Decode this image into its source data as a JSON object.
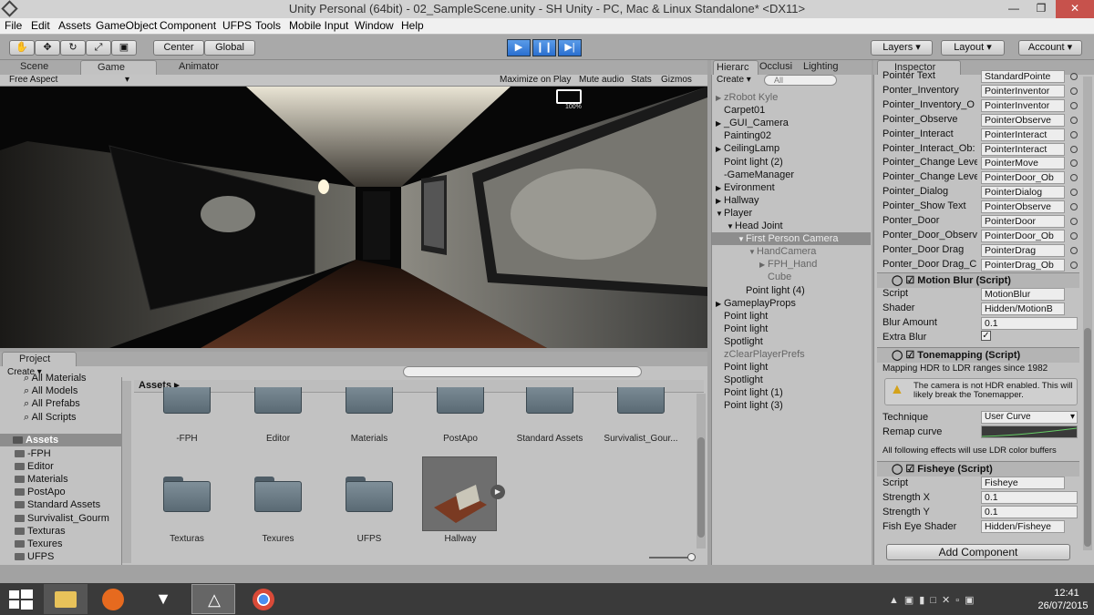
{
  "window": {
    "title": "Unity Personal (64bit) - 02_SampleScene.unity - SH Unity - PC, Mac & Linux Standalone* <DX11>"
  },
  "menu": [
    "File",
    "Edit",
    "Assets",
    "GameObject",
    "Component",
    "UFPS",
    "Tools",
    "Mobile Input",
    "Window",
    "Help"
  ],
  "toolbar": {
    "center": "Center",
    "global": "Global",
    "layers": "Layers",
    "layout": "Layout",
    "account": "Account"
  },
  "scene_tabs": {
    "scene": "Scene",
    "game": "Game",
    "animator": "Animator"
  },
  "game_bar": {
    "aspect": "Free Aspect",
    "maximize": "Maximize on Play",
    "mute": "Mute audio",
    "stats": "Stats",
    "gizmos": "Gizmos"
  },
  "hierarchy": {
    "tabs": [
      "Hierarc",
      "Occlusi",
      "Lighting"
    ],
    "create": "Create",
    "search_placeholder": "All",
    "items": [
      {
        "label": "zRobot Kyle",
        "indent": 0,
        "arrow": true,
        "muted": true
      },
      {
        "label": "Carpet01",
        "indent": 0,
        "arrow": false,
        "muted": false
      },
      {
        "label": "_GUI_Camera",
        "indent": 0,
        "arrow": true,
        "muted": false
      },
      {
        "label": "Painting02",
        "indent": 0,
        "arrow": false,
        "muted": false
      },
      {
        "label": "CeilingLamp",
        "indent": 0,
        "arrow": true,
        "muted": false
      },
      {
        "label": "Point light (2)",
        "indent": 0,
        "arrow": false,
        "muted": false
      },
      {
        "label": "-GameManager",
        "indent": 0,
        "arrow": false,
        "muted": false
      },
      {
        "label": "Evironment",
        "indent": 0,
        "arrow": true,
        "muted": false
      },
      {
        "label": "Hallway",
        "indent": 0,
        "arrow": true,
        "muted": false
      },
      {
        "label": "Player",
        "indent": 0,
        "arrow": true,
        "muted": false,
        "open": true
      },
      {
        "label": "Head Joint",
        "indent": 1,
        "arrow": true,
        "muted": false,
        "open": true
      },
      {
        "label": "First Person Camera",
        "indent": 2,
        "arrow": true,
        "muted": false,
        "open": true,
        "selected": true
      },
      {
        "label": "HandCamera",
        "indent": 3,
        "arrow": true,
        "muted": true,
        "open": true
      },
      {
        "label": "FPH_Hand",
        "indent": 4,
        "arrow": true,
        "muted": true
      },
      {
        "label": "Cube",
        "indent": 4,
        "arrow": false,
        "muted": true
      },
      {
        "label": "Point light (4)",
        "indent": 2,
        "arrow": false,
        "muted": false
      },
      {
        "label": "GameplayProps",
        "indent": 0,
        "arrow": true,
        "muted": false
      },
      {
        "label": "Point light",
        "indent": 0,
        "arrow": false,
        "muted": false
      },
      {
        "label": "Point light",
        "indent": 0,
        "arrow": false,
        "muted": false
      },
      {
        "label": "Spotlight",
        "indent": 0,
        "arrow": false,
        "muted": false
      },
      {
        "label": "zClearPlayerPrefs",
        "indent": 0,
        "arrow": false,
        "muted": true
      },
      {
        "label": "Point light",
        "indent": 0,
        "arrow": false,
        "muted": false
      },
      {
        "label": "Spotlight",
        "indent": 0,
        "arrow": false,
        "muted": false
      },
      {
        "label": "Point light (1)",
        "indent": 0,
        "arrow": false,
        "muted": false
      },
      {
        "label": "Point light (3)",
        "indent": 0,
        "arrow": false,
        "muted": false
      }
    ]
  },
  "inspector": {
    "tab": "Inspector",
    "pointer_rows": [
      {
        "label": "Pointer Text",
        "value": "StandardPointe"
      },
      {
        "label": "Ponter_Inventory",
        "value": "PointerInventor"
      },
      {
        "label": "Pointer_Inventory_O",
        "value": "PointerInventor"
      },
      {
        "label": "Pointer_Observe",
        "value": "PointerObserve"
      },
      {
        "label": "Pointer_Interact",
        "value": "PointerInteract"
      },
      {
        "label": "Pointer_Interact_Ob:",
        "value": "PointerInteract"
      },
      {
        "label": "Pointer_Change Leve",
        "value": "PointerMove"
      },
      {
        "label": "Pointer_Change Leve",
        "value": "PointerDoor_Ob"
      },
      {
        "label": "Pointer_Dialog",
        "value": "PointerDialog"
      },
      {
        "label": "Pointer_Show Text",
        "value": "PointerObserve"
      },
      {
        "label": "Ponter_Door",
        "value": "PointerDoor"
      },
      {
        "label": "Ponter_Door_Observ",
        "value": "PointerDoor_Ob"
      },
      {
        "label": "Ponter_Door Drag",
        "value": "PointerDrag"
      },
      {
        "label": "Ponter_Door Drag_C",
        "value": "PointerDrag_Ob"
      }
    ],
    "motion_blur": {
      "title": "Motion Blur (Script)",
      "script_label": "Script",
      "script": "MotionBlur",
      "shader_label": "Shader",
      "shader": "Hidden/MotionB",
      "blur_label": "Blur Amount",
      "blur": "0.1",
      "extra_label": "Extra Blur"
    },
    "tonemapping": {
      "title": "Tonemapping (Script)",
      "desc": "Mapping HDR to LDR ranges since 1982",
      "warning": "The camera is not HDR enabled. This will likely break the Tonemapper.",
      "technique_label": "Technique",
      "technique": "User Curve",
      "remap_label": "Remap curve",
      "ldr_note": "All following effects will use LDR color buffers"
    },
    "fisheye": {
      "title": "Fisheye (Script)",
      "script_label": "Script",
      "script": "Fisheye",
      "sx_label": "Strength X",
      "sx": "0.1",
      "sy_label": "Strength Y",
      "sy": "0.1",
      "shader_label": "Fish Eye Shader",
      "shader": "Hidden/Fisheye"
    },
    "add_component": "Add Component"
  },
  "project": {
    "tab": "Project",
    "create": "Create",
    "favorites": [
      "All Materials",
      "All Models",
      "All Prefabs",
      "All Scripts"
    ],
    "tree_root": "Assets",
    "tree": [
      "-FPH",
      "Editor",
      "Materials",
      "PostApo",
      "Standard Assets",
      "Survivalist_Gourm",
      "Texturas",
      "Texures",
      "UFPS"
    ],
    "breadcrumb": "Assets",
    "grid_row1": [
      "-FPH",
      "Editor",
      "Materials",
      "PostApo",
      "Standard Assets",
      "Survivalist_Gour..."
    ],
    "grid_row2": [
      "Texturas",
      "Texures",
      "UFPS",
      "Hallway"
    ]
  },
  "game_view": {
    "battery_text": "100%"
  },
  "taskbar": {
    "time": "12:41",
    "date": "26/07/2015"
  },
  "colors": {
    "accent": "#3a78d8",
    "selection": "#8d8d8d",
    "taskbar": "#3a3a3a"
  }
}
